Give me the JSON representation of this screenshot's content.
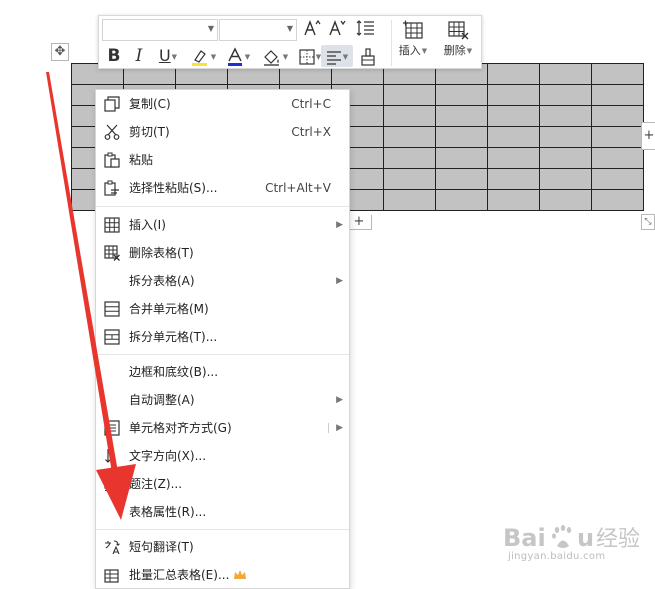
{
  "toolbar": {
    "insert_label": "插入",
    "delete_label": "删除"
  },
  "context_menu": {
    "items": [
      {
        "label": "复制(C)",
        "shortcut": "Ctrl+C"
      },
      {
        "label": "剪切(T)",
        "shortcut": "Ctrl+X"
      },
      {
        "label": "粘贴",
        "shortcut": ""
      },
      {
        "label": "选择性粘贴(S)...",
        "shortcut": "Ctrl+Alt+V"
      },
      {
        "label": "插入(I)"
      },
      {
        "label": "删除表格(T)"
      },
      {
        "label": "拆分表格(A)"
      },
      {
        "label": "合并单元格(M)"
      },
      {
        "label": "拆分单元格(T)..."
      },
      {
        "label": "边框和底纹(B)..."
      },
      {
        "label": "自动调整(A)"
      },
      {
        "label": "单元格对齐方式(G)"
      },
      {
        "label": "文字方向(X)..."
      },
      {
        "label": "题注(Z)..."
      },
      {
        "label": "表格属性(R)..."
      },
      {
        "label": "短句翻译(T)"
      },
      {
        "label": "批量汇总表格(E)..."
      }
    ]
  },
  "table": {
    "rows": 7,
    "cols": 11
  },
  "watermark": {
    "brand_latin_1": "Bai",
    "brand_latin_2": "u",
    "brand_cn": "经验",
    "url": "jingyan.baidu.com"
  },
  "colors": {
    "table_fill": "#c2c2c2",
    "arrow": "#e8362f",
    "menu_hover": "#dde1e8",
    "watermark": "#bcbcbc",
    "crown": "#f0a93a"
  }
}
